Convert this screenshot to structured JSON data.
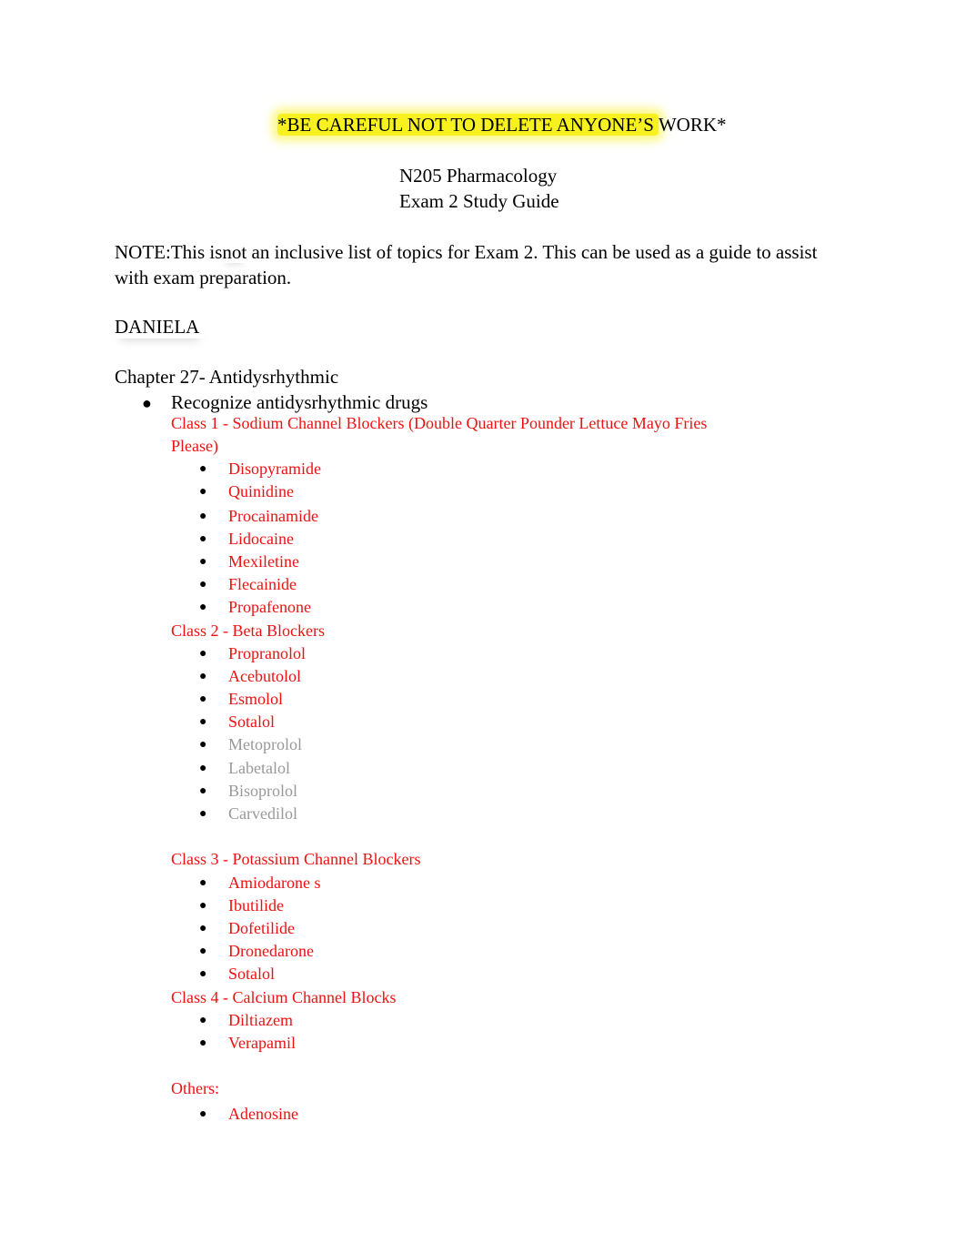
{
  "header": {
    "warning_highlighted": "*BE CAREFUL NOT TO DELETE ANYONE’S ",
    "warning_tail": "WORK*",
    "highlight_color": "#f7f21f",
    "course": "N205 Pharmacology",
    "guide": "Exam 2 Study Guide"
  },
  "note": {
    "prefix": "NOTE:This is",
    "emphasis": "not",
    "rest": " an inclusive list of topics for Exam 2. This can be used as a guide to assist with exam preparation."
  },
  "author": "DANIELA",
  "chapter": {
    "title": "Chapter 27- Antidysrhythmic",
    "topic_bullet": "●",
    "topic": "Recognize antidysrhythmic drugs",
    "accent_color": "#ee1111",
    "muted_color": "#999999",
    "classes": [
      {
        "label": "Class 1 - Sodium Channel Blockers (Double Quarter Pounder Lettuce Mayo Fries Please)",
        "drugs": [
          {
            "name": "Disopyramide",
            "muted": false
          },
          {
            "name": "Quinidine",
            "muted": false
          },
          {
            "name": "Procainamide",
            "muted": false
          },
          {
            "name": "Lidocaine",
            "muted": false
          },
          {
            "name": "Mexiletine",
            "muted": false
          },
          {
            "name": "Flecainide",
            "muted": false
          },
          {
            "name": "Propafenone",
            "muted": false
          }
        ]
      },
      {
        "label": "Class 2 - Beta Blockers",
        "drugs": [
          {
            "name": "Propranolol",
            "muted": false
          },
          {
            "name": "Acebutolol",
            "muted": false
          },
          {
            "name": "Esmolol",
            "muted": false
          },
          {
            "name": "Sotalol",
            "muted": false
          },
          {
            "name": "Metoprolol",
            "muted": true
          },
          {
            "name": "Labetalol",
            "muted": true
          },
          {
            "name": "Bisoprolol",
            "muted": true
          },
          {
            "name": "Carvedilol",
            "muted": true
          }
        ]
      },
      {
        "label": "Class 3 - Potassium Channel Blockers",
        "drugs": [
          {
            "name": "Amiodarone s",
            "muted": false
          },
          {
            "name": "Ibutilide",
            "muted": false
          },
          {
            "name": "Dofetilide",
            "muted": false
          },
          {
            "name": "Dronedarone",
            "muted": false
          },
          {
            "name": "Sotalol",
            "muted": false
          }
        ]
      },
      {
        "label": "Class 4 - Calcium Channel Blocks",
        "drugs": [
          {
            "name": "Diltiazem",
            "muted": false
          },
          {
            "name": "Verapamil",
            "muted": false
          }
        ]
      },
      {
        "label": "Others:",
        "drugs": [
          {
            "name": "Adenosine",
            "muted": false
          }
        ]
      }
    ]
  },
  "bullet_glyph": "●"
}
